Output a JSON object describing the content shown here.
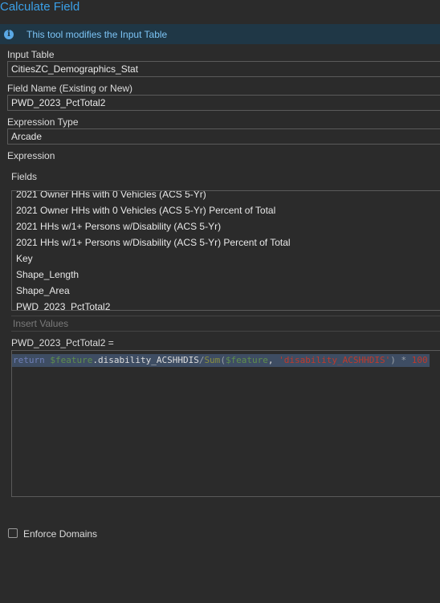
{
  "window": {
    "title": "Calculate Field"
  },
  "info": {
    "icon": "info-icon",
    "text": "This tool modifies the Input Table"
  },
  "input_table": {
    "label": "Input Table",
    "value": "CitiesZC_Demographics_Stat"
  },
  "field_name": {
    "label": "Field Name (Existing or New)",
    "value": "PWD_2023_PctTotal2"
  },
  "expression_type": {
    "label": "Expression Type",
    "value": "Arcade"
  },
  "expression": {
    "label": "Expression",
    "fields_label": "Fields",
    "fields": [
      "2021 Owner HHs with 0 Vehicles (ACS 5-Yr)",
      "2021 Owner HHs with 0 Vehicles (ACS 5-Yr) Percent of Total",
      "2021 HHs w/1+ Persons w/Disability (ACS 5-Yr)",
      "2021 HHs w/1+ Persons w/Disability (ACS 5-Yr) Percent of Total",
      "Key",
      "Shape_Length",
      "Shape_Area",
      "PWD_2023_PctTotal2"
    ],
    "insert_values_label": "Insert Values",
    "target_label": "PWD_2023_PctTotal2 =",
    "code": {
      "t1": "return",
      "t2": " $feature",
      "t3": ".disability_ACSHHDIS",
      "t4": "/",
      "t5": "Sum",
      "t6": "(",
      "t7": "$feature",
      "t8": ", ",
      "t9": "'disability_ACSHHDIS'",
      "t10": ") * ",
      "t11": "100"
    }
  },
  "enforce_domains": {
    "label": "Enforce Domains",
    "checked": false
  }
}
